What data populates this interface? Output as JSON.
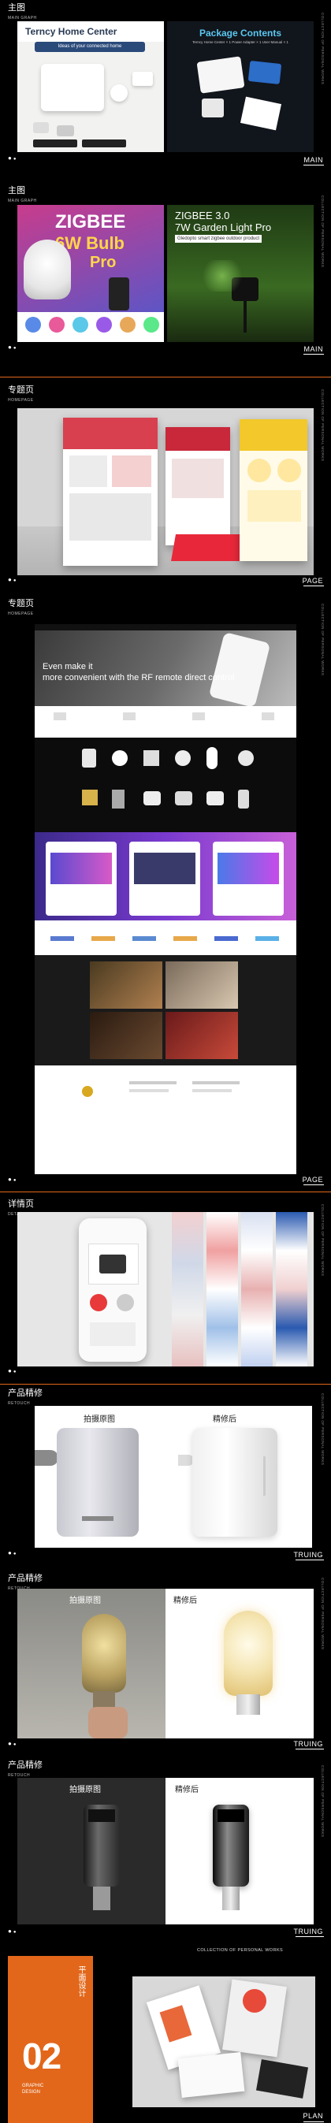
{
  "collection": "COLLECTION OF PERSONAL WORKS",
  "sections": [
    {
      "cn": "主图",
      "en": "MAIN GRAPH",
      "tag": "MAIN"
    },
    {
      "cn": "主图",
      "en": "MAIN GRAPH",
      "tag": "MAIN"
    },
    {
      "cn": "专题页",
      "en": "HOMEPAGE",
      "tag": "PAGE"
    },
    {
      "cn": "专题页",
      "en": "HOMEPAGE",
      "tag": "PAGE"
    },
    {
      "cn": "详情页",
      "en": "DETAILS",
      "tag": ""
    },
    {
      "cn": "产品精修",
      "en": "RETOUCH",
      "tag": "TRUING"
    },
    {
      "cn": "产品精修",
      "en": "RETOUCH",
      "tag": "TRUING"
    },
    {
      "cn": "产品精修",
      "en": "RETOUCH",
      "tag": "TRUING"
    }
  ],
  "main1": {
    "left_title": "Terncy Home Center",
    "left_sub": "Ideas of your connected home",
    "right_title": "Package Contents",
    "right_items": "Terncy Home Center × 1   Power Adapter × 1   User Manual × 1"
  },
  "main2": {
    "left_title_1": "ZIGBEE",
    "left_title_2": "6W Bulb",
    "left_title_3": "Pro",
    "right_title_1": "ZIGBEE 3.0",
    "right_title_2": "7W Garden Light Pro",
    "right_sub": "Gledopto smart zigbee outdoor product"
  },
  "homepage": {
    "hero_text_1": "Even make it",
    "hero_text_2": "more convenient with the RF remote direct control"
  },
  "retouch": {
    "before": "拍摄原图",
    "after": "精修后"
  },
  "plan": {
    "cn": "平面设计",
    "num": "02",
    "en_1": "GRAPHIC",
    "en_2": "DESIGN",
    "tag": "PLAN"
  },
  "colors": {
    "accent": "#e2671a",
    "bg": "#000000"
  }
}
